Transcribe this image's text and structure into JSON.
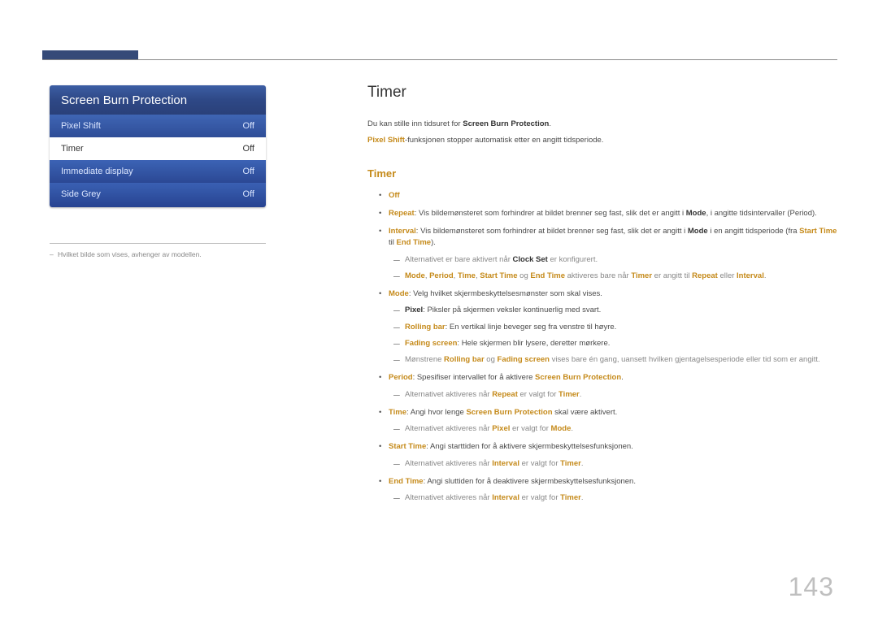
{
  "page_number": "143",
  "panel": {
    "title": "Screen Burn Protection",
    "rows": [
      {
        "label": "Pixel Shift",
        "value": "Off"
      },
      {
        "label": "Timer",
        "value": "Off"
      },
      {
        "label": "Immediate display",
        "value": "Off"
      },
      {
        "label": "Side Grey",
        "value": "Off"
      }
    ]
  },
  "footnote": "Hvilket bilde som vises, avhenger av modellen.",
  "main": {
    "heading": "Timer",
    "intro1_pre": "Du kan stille inn tidsuret for ",
    "intro1_bold": "Screen Burn Protection",
    "intro1_post": ".",
    "intro2_bold": "Pixel Shift",
    "intro2_post": "-funksjonen stopper automatisk etter en angitt tidsperiode.",
    "subheading": "Timer",
    "li_off": "Off",
    "li_repeat_label": "Repeat",
    "li_repeat_text1": ": Vis bildemønsteret som forhindrer at bildet brenner seg fast, slik det er angitt i ",
    "li_repeat_mode": "Mode",
    "li_repeat_text2": ", i angitte tidsintervaller (Period).",
    "li_interval_label": "Interval",
    "li_interval_text1": ": Vis bildemønsteret som forhindrer at bildet brenner seg fast, slik det er angitt i ",
    "li_interval_mode": "Mode",
    "li_interval_text2": " i en angitt tidsperiode (fra ",
    "li_interval_start": "Start Time",
    "li_interval_til": " til ",
    "li_interval_end": "End Time",
    "li_interval_text3": ").",
    "sub_clock_pre": "Alternativet er bare aktivert når ",
    "sub_clock_bold": "Clock Set",
    "sub_clock_post": " er konfigurert.",
    "sub_modes_m": "Mode",
    "sub_modes_sep": ", ",
    "sub_modes_p": "Period",
    "sub_modes_t": "Time",
    "sub_modes_st": "Start Time",
    "sub_modes_og": " og ",
    "sub_modes_et": "End Time",
    "sub_modes_mid": " aktiveres bare når ",
    "sub_modes_timer": "Timer",
    "sub_modes_mid2": " er angitt til ",
    "sub_modes_repeat": "Repeat",
    "sub_modes_eller": " eller ",
    "sub_modes_interval": "Interval",
    "sub_modes_end": ".",
    "li_mode_label": "Mode",
    "li_mode_text": ": Velg hvilket skjermbeskyttelsesmønster som skal vises.",
    "mode_pixel_label": "Pixel",
    "mode_pixel_text": ": Piksler på skjermen veksler kontinuerlig med svart.",
    "mode_rolling_label": "Rolling bar",
    "mode_rolling_text": ": En vertikal linje beveger seg fra venstre til høyre.",
    "mode_fading_label": "Fading screen",
    "mode_fading_text": ": Hele skjermen blir lysere, deretter mørkere.",
    "mode_note_pre": "Mønstrene ",
    "mode_note_r": "Rolling bar",
    "mode_note_og": " og ",
    "mode_note_f": "Fading screen",
    "mode_note_post": " vises bare én gang, uansett hvilken gjentagelsesperiode eller tid som er angitt.",
    "li_period_label": "Period",
    "li_period_text_pre": ": Spesifiser intervallet for å aktivere ",
    "li_period_bold": "Screen Burn Protection",
    "li_period_text_post": ".",
    "period_sub_pre": "Alternativet aktiveres når ",
    "period_sub_r": "Repeat",
    "period_sub_mid": " er valgt for ",
    "period_sub_t": "Timer",
    "period_sub_post": ".",
    "li_time_label": "Time",
    "li_time_text_pre": ": Angi hvor lenge ",
    "li_time_bold": "Screen Burn Protection",
    "li_time_text_post": " skal være aktivert.",
    "time_sub_pre": "Alternativet aktiveres når ",
    "time_sub_p": "Pixel",
    "time_sub_mid": " er valgt for ",
    "time_sub_m": "Mode",
    "time_sub_post": ".",
    "li_start_label": "Start Time",
    "li_start_text": ": Angi starttiden for å aktivere skjermbeskyttelsesfunksjonen.",
    "start_sub_pre": "Alternativet aktiveres når ",
    "start_sub_i": "Interval",
    "start_sub_mid": " er valgt for ",
    "start_sub_t": "Timer",
    "start_sub_post": ".",
    "li_end_label": "End Time",
    "li_end_text": ": Angi sluttiden for å deaktivere skjermbeskyttelsesfunksjonen.",
    "end_sub_pre": "Alternativet aktiveres når ",
    "end_sub_i": "Interval",
    "end_sub_mid": " er valgt for ",
    "end_sub_t": "Timer",
    "end_sub_post": "."
  }
}
